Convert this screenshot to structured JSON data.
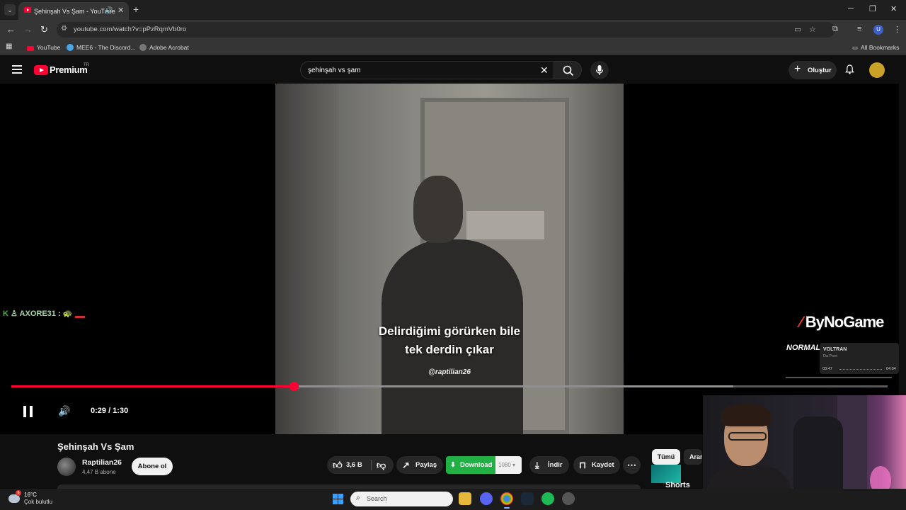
{
  "browser": {
    "tab_title": "Şehinşah Vs Şam - YouTube",
    "tab_close": "✕",
    "tab_list_glyph": "⌄",
    "new_tab_glyph": "+",
    "window_min": "─",
    "window_max": "❐",
    "window_close": "✕",
    "url": "youtube.com/watch?v=pPzRqmVb0ro",
    "profile_initial": "U",
    "bookmarks": [
      "YouTube",
      "MEE6 - The Discord...",
      "Adobe Acrobat"
    ],
    "all_bookmarks": "All Bookmarks"
  },
  "header": {
    "brand": "Premium",
    "region": "TR",
    "search_query": "şehinşah vs şam",
    "create_label": "Oluştur"
  },
  "player": {
    "subtitle_line1": "Delirdiğimi görürken bile",
    "subtitle_line2": "tek derdin çıkar",
    "handle": "@raptilian26",
    "time": "0:29 / 1:30",
    "progress_fraction": 0.322,
    "buffered_fraction": 0.824
  },
  "overlay": {
    "chat_user": "AXORE31",
    "chat_sep": ":",
    "sponsor": "ByNoGame",
    "mode_badge": "NORMAL",
    "song_title": "VOLTRAN",
    "song_artist": "Da Poet",
    "song_elapsed": "03:47",
    "song_total": "04:04"
  },
  "video": {
    "title": "Şehinşah Vs Şam",
    "channel": "Raptilian26",
    "subscribers": "4,47 B abone",
    "subscribe_label": "Abone ol",
    "likes": "3,6 B",
    "share_label": "Paylaş",
    "download_label": "Download",
    "download_quality": "1080",
    "indir_label": "İndir",
    "save_label": "Kaydet",
    "more_glyph": "⋯"
  },
  "sidebar": {
    "chips": [
      "Tümü",
      "Aran"
    ],
    "shorts_label": "Shorts"
  },
  "taskbar": {
    "temperature": "16°C",
    "condition": "Çok bulutlu",
    "weather_badge": "6",
    "search_label": "Search"
  },
  "colors": {
    "accent": "#ff0033",
    "download_green": "#21b043",
    "background": "#0f0f0f"
  },
  "icons": [
    "search-icon",
    "mic-icon",
    "bell-icon",
    "like-icon",
    "dislike-icon",
    "share-icon",
    "download-icon",
    "bookmark-icon",
    "pause-icon",
    "volume-icon",
    "windows-icon"
  ]
}
